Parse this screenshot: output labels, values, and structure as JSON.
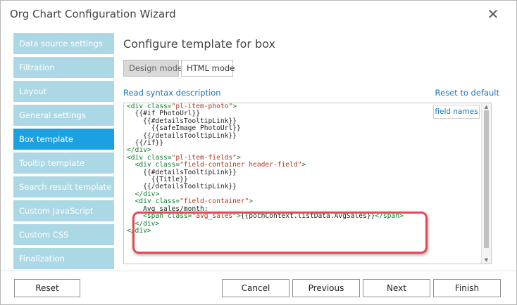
{
  "window": {
    "title": "Org Chart Configuration Wizard",
    "close_icon": "close-icon"
  },
  "sidebar": {
    "items": [
      {
        "label": "Data source settings"
      },
      {
        "label": "Filtration"
      },
      {
        "label": "Layout"
      },
      {
        "label": "General settings"
      },
      {
        "label": "Box template",
        "active": true
      },
      {
        "label": "Tooltip template"
      },
      {
        "label": "Search result template"
      },
      {
        "label": "Custom JavaScript"
      },
      {
        "label": "Custom CSS"
      },
      {
        "label": "Finalization"
      }
    ]
  },
  "main": {
    "title": "Configure template for box",
    "modes": {
      "design": "Design mode",
      "html": "HTML mode",
      "selected": "Design mode"
    },
    "syntax_link": "Read syntax description",
    "reset_default_link": "Reset to default",
    "field_names_button": "field names"
  },
  "editor": {
    "lines": [
      [
        [
          "tag",
          "<div "
        ],
        [
          "attr",
          "class="
        ],
        [
          "str",
          "\"pl-item-photo\""
        ],
        [
          "tag",
          ">"
        ]
      ],
      [
        [
          "txt",
          "  {{#if PhotoUrl}}"
        ]
      ],
      [
        [
          "txt",
          "    {{#detailsTooltipLink}}"
        ]
      ],
      [
        [
          "txt",
          "      {{safeImage PhotoUrl}}"
        ]
      ],
      [
        [
          "txt",
          "    {{/detailsTooltipLink}}"
        ]
      ],
      [
        [
          "txt",
          "  {{/if}}"
        ]
      ],
      [
        [
          "tag",
          "</div>"
        ]
      ],
      [
        [
          "tag",
          "<div "
        ],
        [
          "attr",
          "class="
        ],
        [
          "str",
          "\"pl-item-fields\""
        ],
        [
          "tag",
          ">"
        ]
      ],
      [
        [
          "tag",
          "  <div "
        ],
        [
          "attr",
          "class="
        ],
        [
          "str",
          "\"field-container header-field\""
        ],
        [
          "tag",
          ">"
        ]
      ],
      [
        [
          "txt",
          "    {{#detailsTooltipLink}}"
        ]
      ],
      [
        [
          "txt",
          "      {{Title}}"
        ]
      ],
      [
        [
          "txt",
          "    {{/detailsTooltipLink}}"
        ]
      ],
      [
        [
          "tag",
          "  </div>"
        ]
      ],
      [
        [
          "tag",
          "  <div "
        ],
        [
          "attr",
          "class="
        ],
        [
          "str",
          "\"field-container\""
        ],
        [
          "tag",
          ">"
        ]
      ],
      [
        [
          "txt",
          "    Avg sales/month:"
        ]
      ],
      [
        [
          "tag",
          "    <span "
        ],
        [
          "attr",
          "class="
        ],
        [
          "str",
          "\"avg_sales\""
        ],
        [
          "tag",
          ">"
        ],
        [
          "txt",
          "{{pochContext.listData.AvgSales}}"
        ],
        [
          "tag",
          "</span>"
        ]
      ],
      [
        [
          "tag",
          "  </div>"
        ]
      ],
      [
        [
          "tag",
          "</div>"
        ]
      ]
    ]
  },
  "footer": {
    "reset": "Reset",
    "cancel": "Cancel",
    "previous": "Previous",
    "next": "Next",
    "finish": "Finish"
  },
  "colors": {
    "sidebar_item": "#acd8e6",
    "sidebar_active": "#1ba1e2",
    "link": "#1a74b8",
    "highlight": "#e04b55"
  }
}
